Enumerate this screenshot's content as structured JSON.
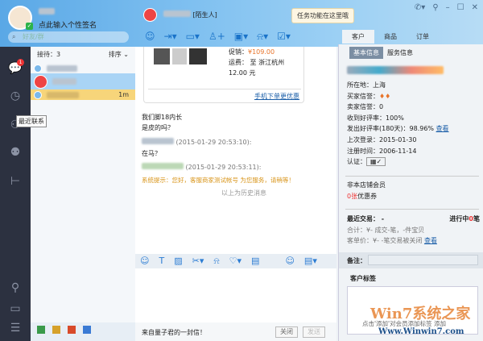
{
  "profile": {
    "signature": "点此输入个性签名",
    "search_placeholder": "好友/群"
  },
  "sidebar": {
    "badge": "1",
    "tooltip": "最近联系"
  },
  "contacts": {
    "waiting_label": "接待：3",
    "sort_label": "排序",
    "items": [
      {
        "time": ""
      },
      {
        "time": ""
      },
      {
        "time": "1m"
      }
    ]
  },
  "chat": {
    "contact_suffix": "陌生人]",
    "tooltip": "任务功能在这里哦",
    "product": {
      "price_label": "促销：",
      "price": "¥109.00",
      "shipping": "运费： 至 浙江杭州 12.00 元",
      "mobile_link": "手机下单更优惠"
    },
    "messages": [
      {
        "text": "我们脚18内长"
      },
      {
        "text": "是皮的吗？"
      },
      {
        "stamp": "(2015-01-29 20:53:10):"
      },
      {
        "text": "在马？"
      },
      {
        "stamp": "(2015-01-29 20:53:11):"
      },
      {
        "system": "系统提示：您好，客服商家测试帐号                为您服务，请稍等！"
      }
    ],
    "history_label": "以上为历史消息",
    "footer_message": "来自量子君的一封信！",
    "close_button": "关闭",
    "send_button": "发送"
  },
  "right_tabs": [
    "客户",
    "商品",
    "订单"
  ],
  "customer": {
    "tabs": [
      "基本信息",
      "服务信息"
    ],
    "location": "所在地：上海",
    "buyer_credit": "买家信誉：",
    "seller_credit": "卖家信誉：0",
    "good_rate_received": "收到好评率：100%",
    "good_rate_given": "发出好评率(180天)：98.96%",
    "view": "查看",
    "last_login": "上次登录：2015-01-30",
    "registered": "注册时间：2006-11-14",
    "auth": "认证：",
    "member": "非本店铺会员",
    "coupon_count": "0张",
    "coupon_label": "优惠券",
    "recent_trade": "最近交易： -",
    "in_progress": "进行中",
    "in_progress_count": "0",
    "in_progress_unit": "笔",
    "total": "合计：¥-   成交-笔，-件宝贝",
    "unit_price": "客单价：¥-   -笔交易被关闭",
    "view2": "查看",
    "note_label": "备注：",
    "tags_label": "客户标签",
    "tags_hint": "点击'添加'对会员添加标签 添加"
  },
  "watermark": {
    "brand": "Win7系统之家",
    "url": "Www.Winwin7.com"
  }
}
